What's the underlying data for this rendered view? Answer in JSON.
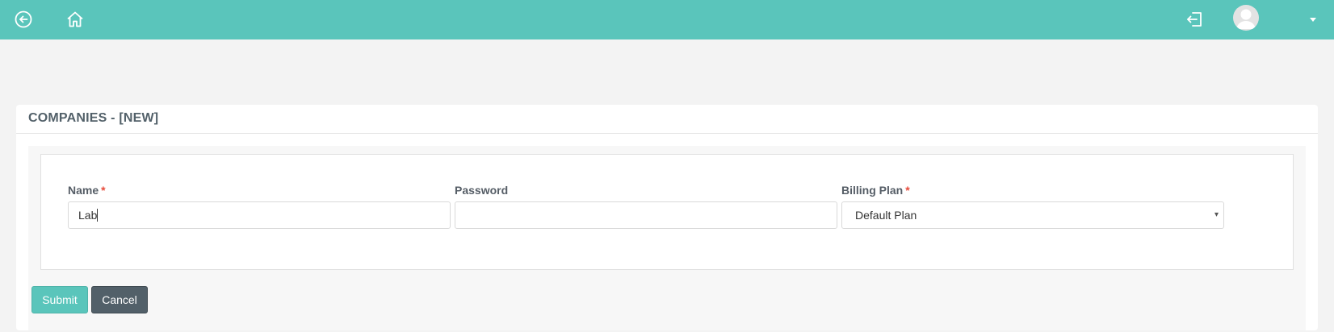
{
  "topbar": {
    "back_icon": "arrow-left-circle-icon",
    "home_icon": "home-icon",
    "logout_icon": "sign-out-icon",
    "avatar_icon": "user-avatar-icon",
    "menu_icon": "caret-down-icon",
    "color": "#5ac5bb"
  },
  "panel": {
    "title": "COMPANIES - [NEW]"
  },
  "form": {
    "name": {
      "label": "Name",
      "required_mark": "*",
      "value": "Lab"
    },
    "password": {
      "label": "Password",
      "value": ""
    },
    "billing_plan": {
      "label": "Billing Plan",
      "required_mark": "*",
      "selected": "Default Plan",
      "arrow": "▾"
    }
  },
  "buttons": {
    "submit": "Submit",
    "cancel": "Cancel"
  },
  "colors": {
    "accent": "#5ac5bb",
    "required": "#e74c3c",
    "cancel": "#526069"
  }
}
